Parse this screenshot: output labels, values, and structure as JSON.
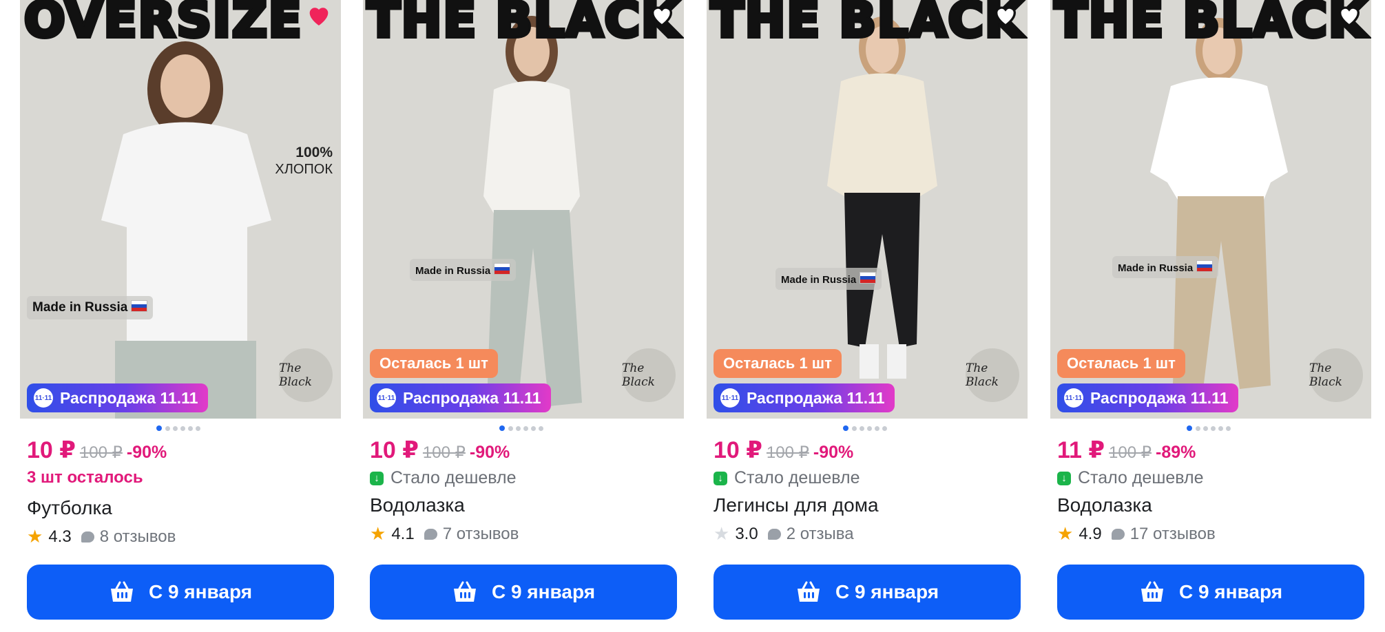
{
  "products": [
    {
      "banner": "OVERSIZE",
      "badge_text": "100%",
      "badge_sub": "ХЛОПОК",
      "made_in": "Made in Russia",
      "logo": "The Black",
      "left_stock_badge": "",
      "sale": "Распродажа 11.11",
      "sale_icon": "11·11",
      "price_now": "10 ₽",
      "price_old": "100 ₽",
      "discount": "-90%",
      "status": "3 шт осталось",
      "title": "Футболка",
      "rating": "4.3",
      "reviews": "8 отзывов",
      "button": "С 9 января",
      "top_color": "#ffffff",
      "bottom_color": "#b9c2bc"
    },
    {
      "banner": "THE BLACK",
      "made_in": "Made in Russia",
      "logo": "The Black",
      "left_stock_badge": "Осталась 1 шт",
      "sale": "Распродажа 11.11",
      "sale_icon": "11·11",
      "price_now": "10 ₽",
      "price_old": "100 ₽",
      "discount": "-90%",
      "status": "Стало дешевле",
      "title": "Водолазка",
      "rating": "4.1",
      "reviews": "7 отзывов",
      "button": "С 9 января",
      "top_color": "#f3f2ee",
      "bottom_color": "#b8c1bb"
    },
    {
      "banner": "THE BLACK",
      "made_in": "Made in Russia",
      "logo": "The Black",
      "left_stock_badge": "Осталась 1 шт",
      "sale": "Распродажа 11.11",
      "sale_icon": "11·11",
      "price_now": "10 ₽",
      "price_old": "100 ₽",
      "discount": "-90%",
      "status": "Стало дешевле",
      "title": "Легинсы для дома",
      "rating": "3.0",
      "reviews": "2 отзыва",
      "button": "С 9 января",
      "top_color": "#efe8d8",
      "bottom_color": "#1d1d1f"
    },
    {
      "banner": "THE BLACK",
      "made_in": "Made in Russia",
      "logo": "The Black",
      "left_stock_badge": "Осталась 1 шт",
      "sale": "Распродажа 11.11",
      "sale_icon": "11·11",
      "price_now": "11 ₽",
      "price_old": "100 ₽",
      "discount": "-89%",
      "status": "Стало дешевле",
      "title": "Водолазка",
      "rating": "4.9",
      "reviews": "17 отзывов",
      "button": "С 9 января",
      "top_color": "#ffffff",
      "bottom_color": "#cbb99c"
    }
  ],
  "colors": {
    "accent_price": "#e1197a",
    "button": "#0d5ef7",
    "star": "#f5a300",
    "sale_gradient_start": "#2f4fe8",
    "sale_gradient_end": "#e23ac8"
  },
  "icons": [
    "heart-icon",
    "basket-icon",
    "star-icon",
    "comment-icon",
    "price-down-icon",
    "sale-icon"
  ]
}
